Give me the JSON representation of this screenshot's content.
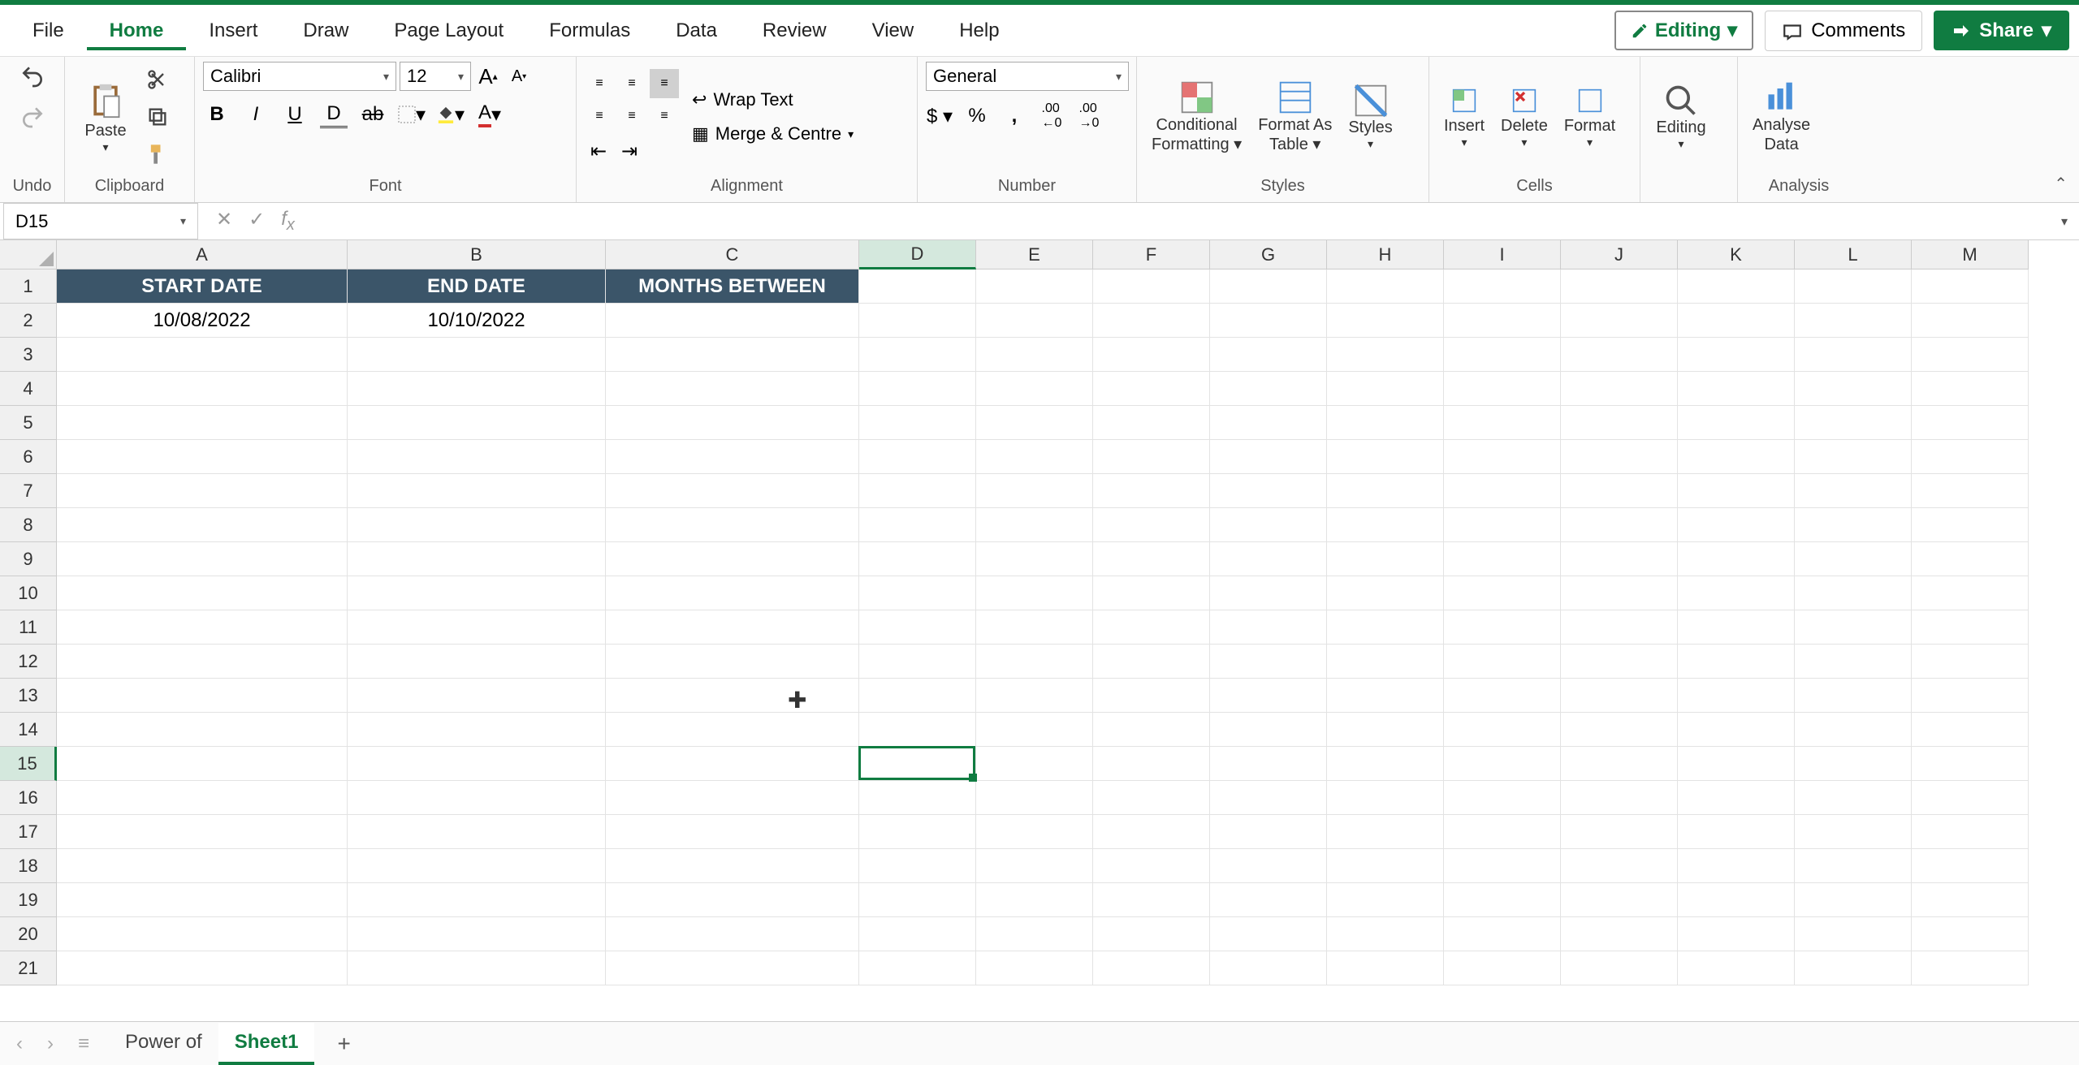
{
  "menu": {
    "items": [
      "File",
      "Home",
      "Insert",
      "Draw",
      "Page Layout",
      "Formulas",
      "Data",
      "Review",
      "View",
      "Help"
    ],
    "active": 1
  },
  "topbar": {
    "editing": "Editing",
    "comments": "Comments",
    "share": "Share"
  },
  "ribbon": {
    "undo_label": "Undo",
    "clipboard": {
      "paste": "Paste",
      "label": "Clipboard"
    },
    "font": {
      "name": "Calibri",
      "size": "12",
      "label": "Font"
    },
    "alignment": {
      "wrap": "Wrap Text",
      "merge": "Merge & Centre",
      "label": "Alignment"
    },
    "number": {
      "format": "General",
      "label": "Number"
    },
    "styles": {
      "cond": "Conditional Formatting",
      "table": "Format As Table",
      "styles": "Styles",
      "label": "Styles"
    },
    "cells": {
      "insert": "Insert",
      "delete": "Delete",
      "format": "Format",
      "label": "Cells"
    },
    "editing": {
      "edit": "Editing",
      "label": ""
    },
    "analysis": {
      "analyse": "Analyse Data",
      "label": "Analysis"
    }
  },
  "namebox": "D15",
  "formula": "",
  "columns": [
    "A",
    "B",
    "C",
    "D",
    "E",
    "F",
    "G",
    "H",
    "I",
    "J",
    "K",
    "L",
    "M"
  ],
  "col_widths": [
    "colA",
    "colB",
    "colC",
    "colD",
    "colStd",
    "colStd",
    "colStd",
    "colStd",
    "colStd",
    "colStd",
    "colStd",
    "colStd",
    "colStd"
  ],
  "sel_col": 3,
  "rows": 21,
  "sel_row": 15,
  "headers": [
    "START DATE",
    "END DATE",
    "MONTHS BETWEEN"
  ],
  "data_row": [
    "10/08/2022",
    "10/10/2022",
    ""
  ],
  "sheets": {
    "tabs": [
      "Power of",
      "Sheet1"
    ],
    "active": 1
  }
}
